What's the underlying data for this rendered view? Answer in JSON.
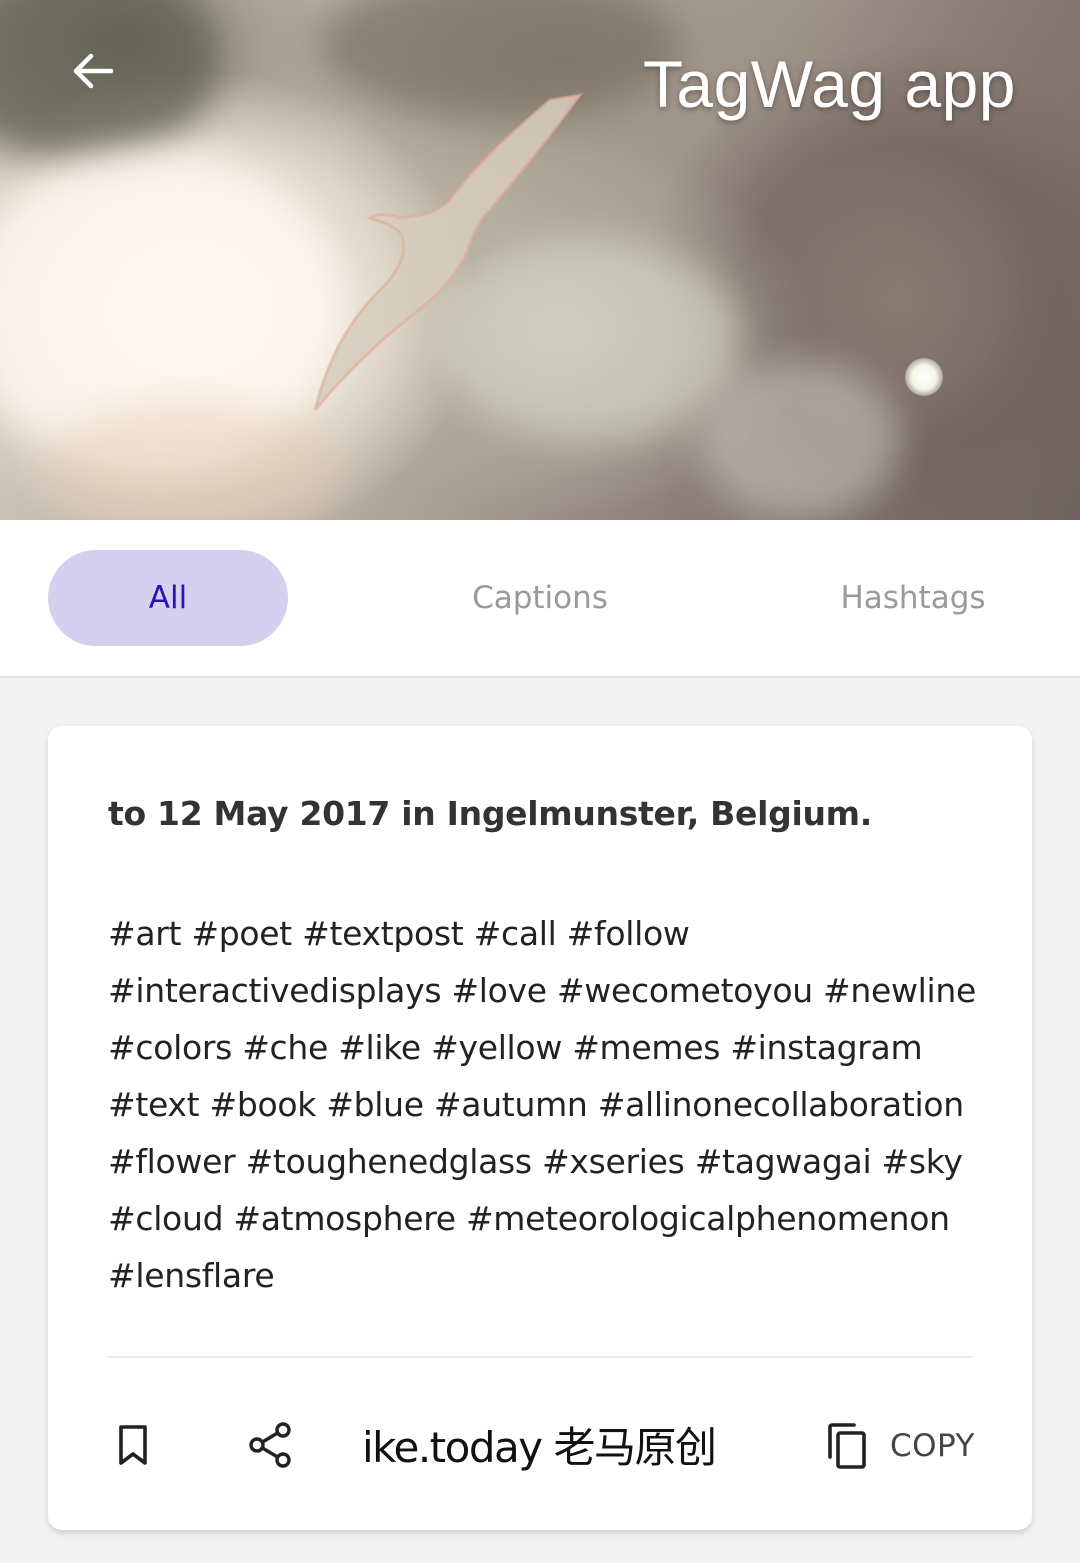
{
  "header": {
    "title": "TagWag app",
    "back_icon": "arrow-left-icon"
  },
  "tabs": [
    {
      "label": "All",
      "active": true
    },
    {
      "label": "Captions",
      "active": false
    },
    {
      "label": "Hashtags",
      "active": false
    }
  ],
  "card": {
    "caption": "to 12 May 2017 in Ingelmunster, Belgium.",
    "hashtags": "#art #poet #textpost #call #follow\n#interactivedisplays #love #wecometoyou #newline\n#colors #che #like #yellow #memes #instagram\n#text #book #blue #autumn #allinonecollaboration\n#flower #toughenedglass #xseries #tagwagai #sky\n#cloud #atmosphere #meteorologicalphenomenon\n#lensflare",
    "actions": {
      "bookmark_icon": "bookmark-icon",
      "share_icon": "share-icon",
      "copy_icon": "copy-icon",
      "copy_label": "COPY"
    },
    "watermark": "ike.today 老马原创"
  },
  "colors": {
    "accent": "#2b12b8",
    "active_tab_bg": "#d5cff0",
    "inactive_tab_text": "#9a9a9a",
    "page_bg": "#f2f2f2"
  }
}
